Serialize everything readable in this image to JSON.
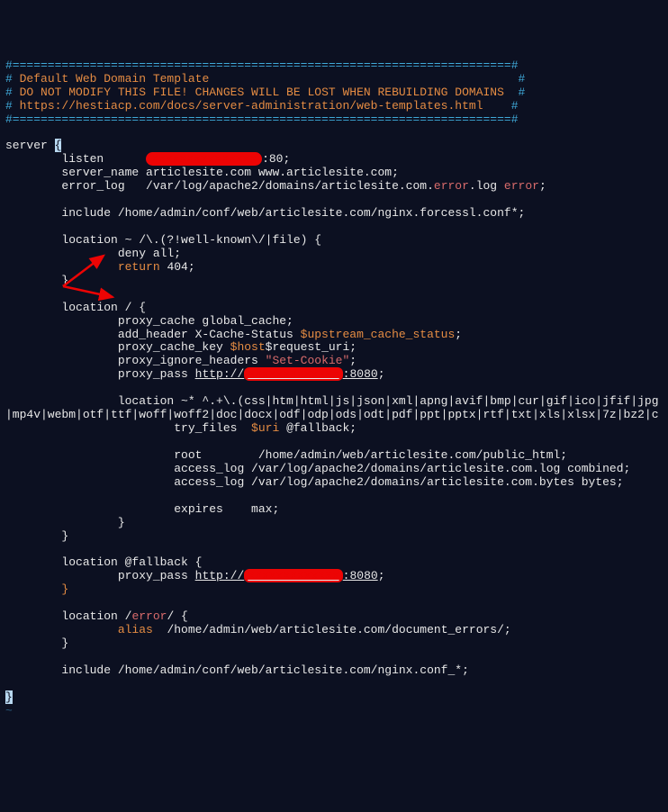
{
  "header": {
    "line1": "#=======================================================================#",
    "line2_a": "# ",
    "line2_b": "Default Web Domain Template",
    "line2_c": "                                            #",
    "line3_a": "# ",
    "line3_b": "DO NOT MODIFY THIS FILE! CHANGES WILL BE LOST WHEN REBUILDING DOMAINS",
    "line3_c": "  #",
    "line4_a": "# ",
    "line4_b": "https://hestiacp.com/docs/server-administration/web-templates.html",
    "line4_c": "    #",
    "line5": "#=======================================================================#"
  },
  "s": {
    "server": "server ",
    "cursor": "{",
    "listen_a": "        listen      ",
    "redact1": "xxxxxxxxxxxxxxx",
    "listen_b": ":80;",
    "server_name": "        server_name articlesite.com www.articlesite.com;",
    "errorlog_a": "        error_log   /var/log/apache2/domains/articlesite.com.",
    "errorlog_b": "error",
    "errorlog_c": ".log ",
    "errorlog_d": "error",
    "errorlog_e": ";",
    "include1": "        include /home/admin/conf/web/articlesite.com/nginx.forcessl.conf*;",
    "loc1_a": "        location ~ /\\.(?!well-known\\/|file) {",
    "loc1_b": "                deny all;",
    "loc1_c_a": "                ",
    "loc1_c_b": "return",
    "loc1_c_c": " 404;",
    "loc1_d": "        }",
    "loc2": "        location / {",
    "pc": "                proxy_cache global_cache;",
    "ah_a": "                add_header X-Cache-Status ",
    "ah_b": "$upstream_cache_status",
    "ah_c": ";",
    "pck_a": "                proxy_cache_key ",
    "pck_b": "$host",
    "pck_c": "$request_uri;",
    "pih_a": "                proxy_ignore_headers ",
    "pih_b": "\"Set-Cookie\"",
    "pih_c": ";",
    "pp1_a": "                proxy_pass ",
    "pp1_url": "http://",
    "redact2": "xxxxxxxxxxxxx",
    "pp1_port": ":8080",
    "pp1_b": ";",
    "staticloc": "                location ~* ^.+\\.(css|htm|html|js|json|xml|apng|avif|bmp|cur|gif|ico|jfif|jpg",
    "staticext": "|mp4v|webm|otf|ttf|woff|woff2|doc|docx|odf|odp|ods|odt|pdf|ppt|pptx|rtf|txt|xls|xlsx|7z|bz2|c",
    "tf_a": "                        try_files  ",
    "tf_b": "$uri",
    "tf_c": " @fallback;",
    "root": "                        root        /home/admin/web/articlesite.com/public_html;",
    "al1": "                        access_log /var/log/apache2/domains/articlesite.com.log combined;",
    "al2": "                        access_log /var/log/apache2/domains/articlesite.com.bytes bytes;",
    "exp": "                        expires    max;",
    "brace1": "                }",
    "brace2": "        }",
    "fb": "        location @fallback {",
    "pp2_a": "                proxy_pass ",
    "pp2_url": "http://",
    "redact3": "xxxxxxxxxxxxx",
    "pp2_port": ":8080",
    "pp2_b": ";",
    "brace3": "        ",
    "brace3b": "}",
    "err_a": "        location /",
    "err_b": "error",
    "err_c": "/ {",
    "alias_a": "                ",
    "alias_b": "alias",
    "alias_c": "  /home/admin/web/articlesite.com/document_errors/;",
    "brace4": "        }",
    "include2": "        include /home/admin/conf/web/articlesite.com/nginx.conf_*;",
    "end": "}",
    "tilde": "~"
  }
}
